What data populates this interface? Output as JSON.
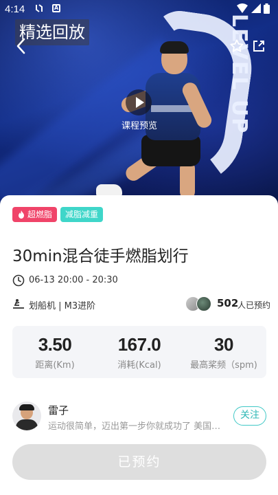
{
  "status_bar": {
    "time": "4:14",
    "box_icon_letter": "A"
  },
  "hero": {
    "title_tag": "精选回放",
    "preview_label": "课程预览",
    "poster_text": "LEVEL UP"
  },
  "tags": [
    {
      "label": "超燃脂",
      "color": "#f04469"
    },
    {
      "label": "减脂减重",
      "color": "#3fd6c9"
    }
  ],
  "course": {
    "title": "30min混合徒手燃脂划行",
    "time": "06-13 20:00 - 20:30",
    "equipment": "划船机 | M3进阶",
    "booked_count": "502",
    "booked_suffix": "人已预约"
  },
  "stats": [
    {
      "value": "3.50",
      "label": "距离(Km)"
    },
    {
      "value": "167.0",
      "label": "消耗(Kcal)"
    },
    {
      "value": "30",
      "label": "最高桨频（spm)"
    }
  ],
  "coach": {
    "name": "雷子",
    "bio": "运动很简单，迈出第一步你就成功了 美国…",
    "follow_label": "关注"
  },
  "action": {
    "booked_label": "已预约"
  },
  "colors": {
    "accent": "#3fc8c6",
    "hot": "#f04469",
    "disabled": "#dedede"
  }
}
